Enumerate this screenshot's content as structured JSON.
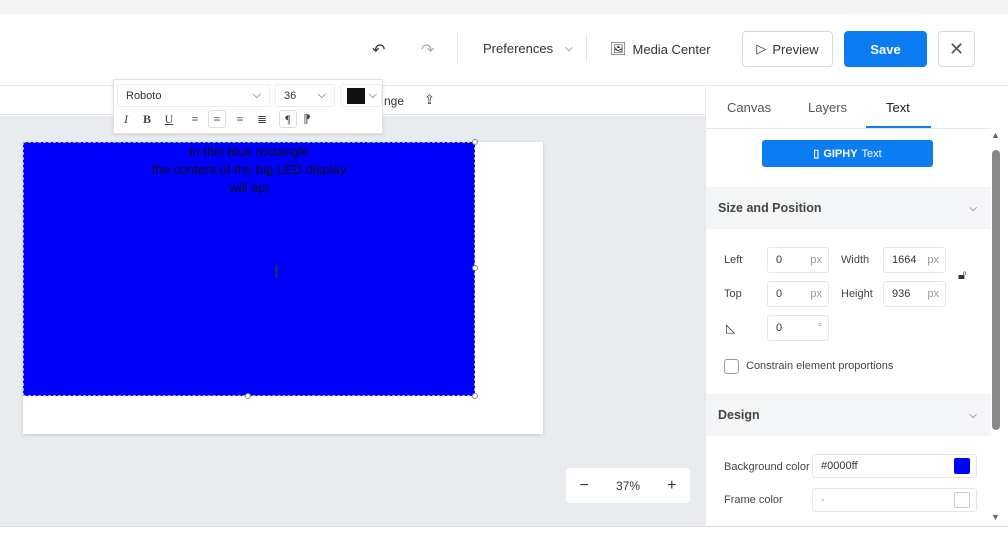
{
  "header": {
    "preferences": "Preferences",
    "media_center": "Media Center",
    "preview": "Preview",
    "save": "Save"
  },
  "toolbar": {
    "arrange_partial": "nge"
  },
  "font_panel": {
    "font": "Roboto",
    "size": "36",
    "color": "#000000"
  },
  "canvas": {
    "text_lines": [
      "In this blue rectangle",
      "the content of the big LED display",
      "will ap|"
    ],
    "rect_color": "#0000ff",
    "zoom": "37%"
  },
  "sidebar": {
    "tabs": [
      "Canvas",
      "Layers",
      "Text"
    ],
    "active_tab": "Text",
    "giphy_label": "GIPHY",
    "giphy_text": "Text",
    "size_position": {
      "title": "Size and Position",
      "left_label": "Left",
      "left": "0",
      "top_label": "Top",
      "top": "0",
      "width_label": "Width",
      "width": "1664",
      "height_label": "Height",
      "height": "936",
      "rotation": "0",
      "unit": "px",
      "deg": "°",
      "constrain": "Constrain element proportions"
    },
    "design": {
      "title": "Design",
      "bg_label": "Background color",
      "bg_value": "#0000ff",
      "frame_label": "Frame color",
      "frame_value": "-"
    }
  }
}
